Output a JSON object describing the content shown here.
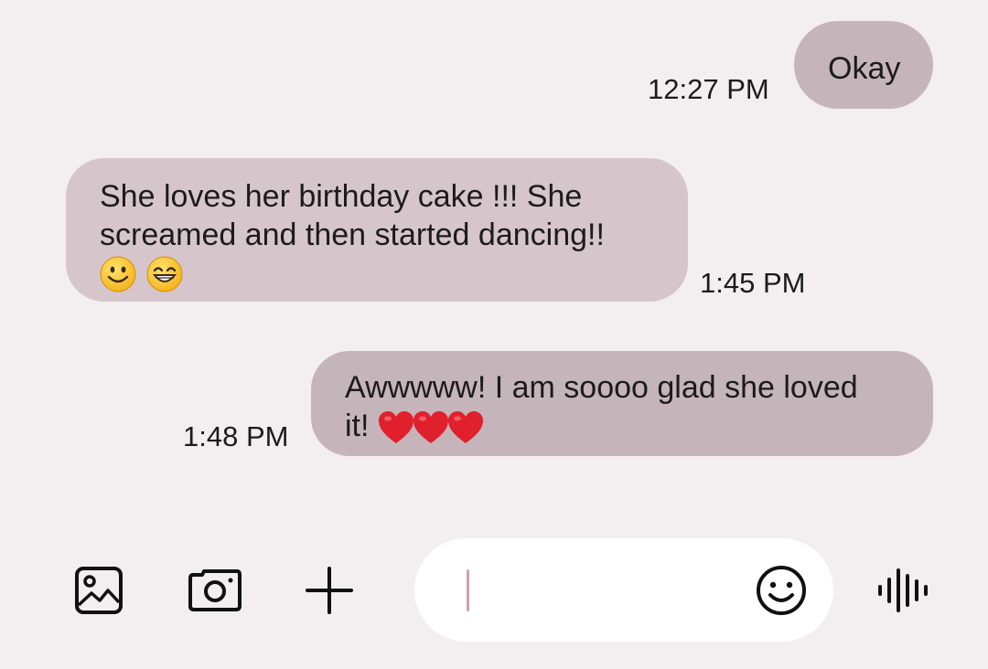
{
  "messages": [
    {
      "direction": "outgoing",
      "text": "Okay",
      "time": "12:27 PM"
    },
    {
      "direction": "incoming",
      "line1": "She loves her birthday cake !!! She",
      "line2": "screamed and then started dancing!!",
      "emojis": [
        "slightly-smiling-face",
        "grinning-face-with-smiling-eyes"
      ],
      "time": "1:45 PM"
    },
    {
      "direction": "outgoing",
      "line1": "Awwwww! I am soooo glad she loved",
      "line2": "it! ",
      "emojis": [
        "red-heart",
        "red-heart",
        "red-heart"
      ],
      "time": "1:48 PM"
    }
  ],
  "composer": {
    "placeholder": "",
    "icons": [
      "gallery-icon",
      "camera-icon",
      "plus-icon",
      "emoji-icon",
      "voice-icon"
    ]
  },
  "colors": {
    "background": "#f3eef0",
    "outgoing_bubble": "#c6b4bb",
    "incoming_bubble": "#d6c6cb",
    "composer": "#ffffff",
    "cursor": "#c9a3b3"
  }
}
